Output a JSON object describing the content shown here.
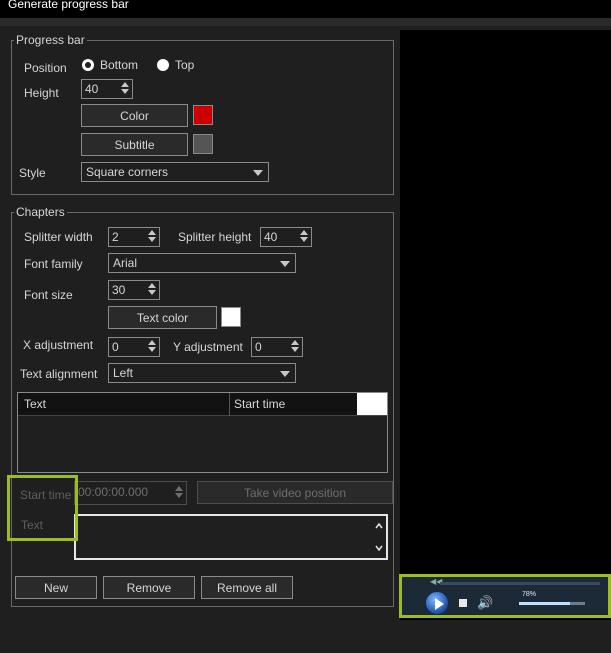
{
  "window": {
    "title": "Generate progress bar"
  },
  "progress_bar": {
    "legend": "Progress bar",
    "position_label": "Position",
    "position_options": [
      "Bottom",
      "Top"
    ],
    "position_selected": "Bottom",
    "height_label": "Height",
    "height_value": "40",
    "color_button": "Color",
    "color_value": "#cc0000",
    "subtitle_button": "Subtitle",
    "subtitle_color_value": "#555555",
    "style_label": "Style",
    "style_value": "Square corners"
  },
  "chapters": {
    "legend": "Chapters",
    "splitter_width_label": "Splitter width",
    "splitter_width_value": "2",
    "splitter_height_label": "Splitter height",
    "splitter_height_value": "40",
    "font_family_label": "Font family",
    "font_family_value": "Arial",
    "font_size_label": "Font size",
    "font_size_value": "30",
    "text_color_button": "Text color",
    "text_color_value": "#ffffff",
    "x_adjustment_label": "X adjustment",
    "x_adjustment_value": "0",
    "y_adjustment_label": "Y adjustment",
    "y_adjustment_value": "0",
    "text_alignment_label": "Text alignment",
    "text_alignment_value": "Left",
    "table_columns": [
      "Text",
      "Start time"
    ],
    "start_time_label": "Start time",
    "start_time_value": "00:00:00.000",
    "take_video_position_button": "Take video position",
    "text_label": "Text",
    "text_value": "",
    "new_button": "New",
    "remove_button": "Remove",
    "remove_all_button": "Remove all"
  },
  "player": {
    "volume_percent": "78%",
    "volume_level": 0.78
  },
  "colors": {
    "highlight": "#9bbd22",
    "background": "#1f1f1f"
  }
}
